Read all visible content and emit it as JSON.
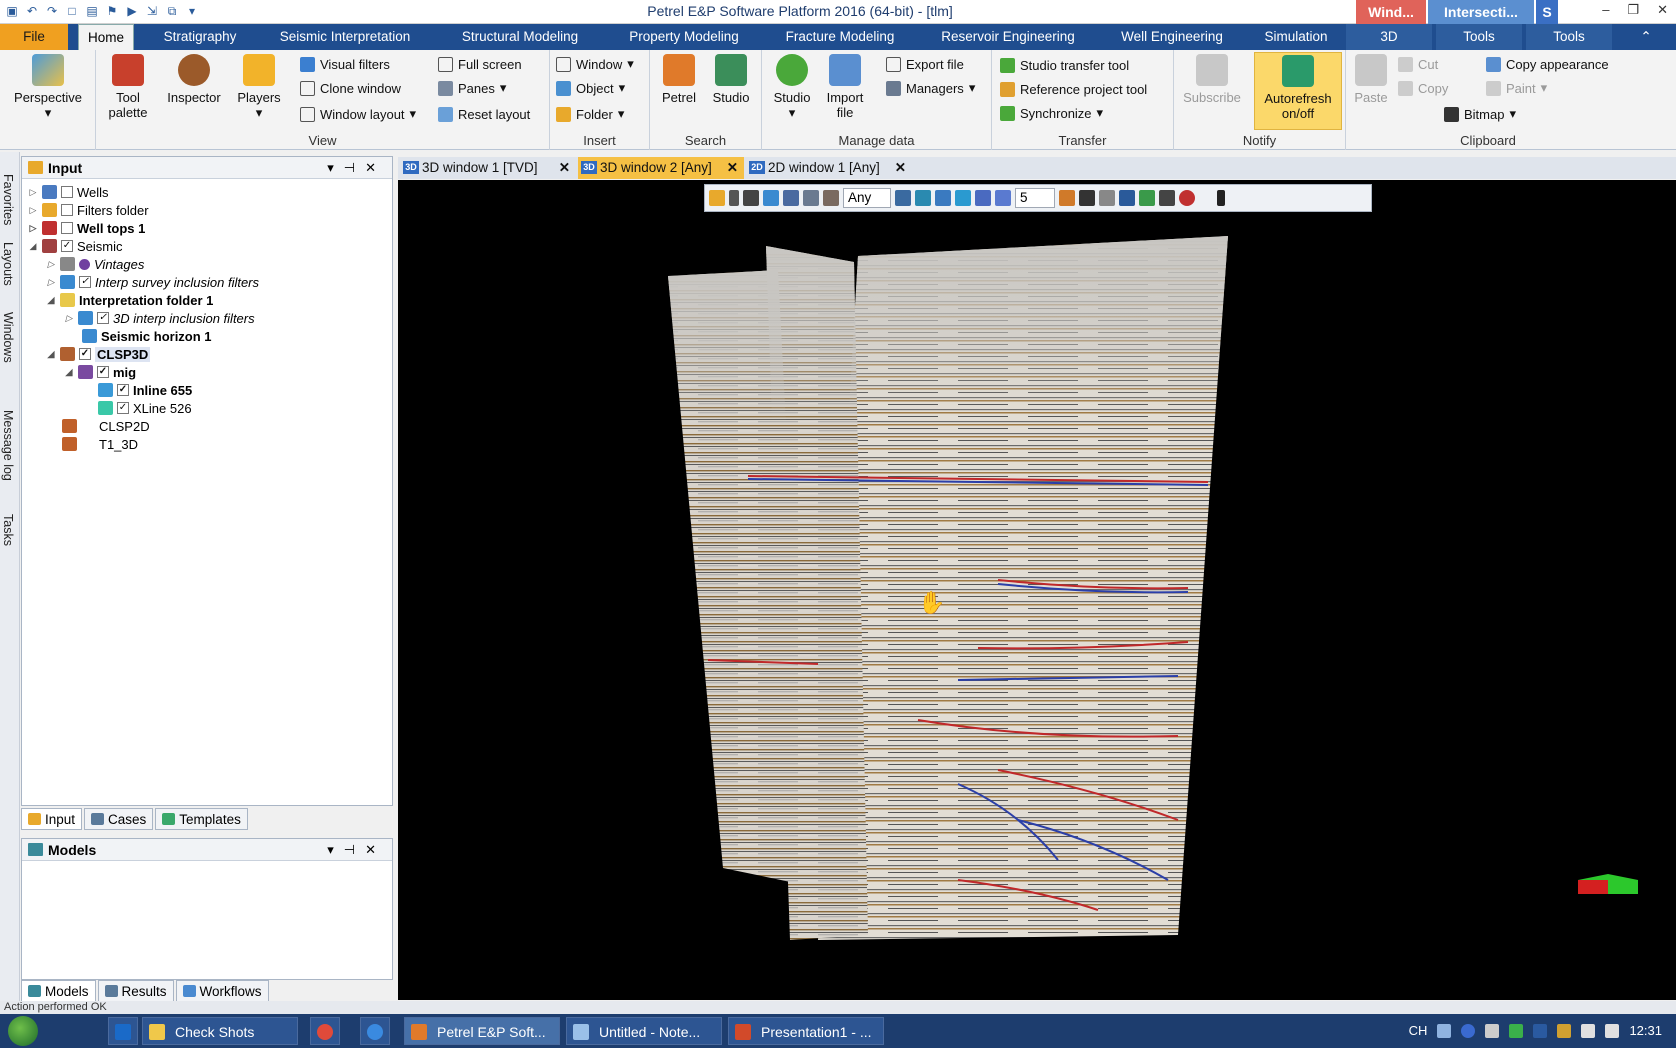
{
  "window": {
    "title": "Petrel E&P Software Platform 2016 (64-bit) - [tlm]",
    "context_tabs": [
      "Wind...",
      "Intersecti...",
      "S"
    ],
    "min": "–",
    "max": "❐",
    "close": "✕"
  },
  "tabs": {
    "file": "File",
    "home": "Home",
    "items": [
      "Stratigraphy",
      "Seismic Interpretation",
      "Structural Modeling",
      "Property Modeling",
      "Fracture Modeling",
      "Reservoir Engineering",
      "Well Engineering",
      "Simulation",
      "3D",
      "Tools",
      "Tools"
    ]
  },
  "ribbon": {
    "perspective": "Perspective",
    "view": {
      "label": "View",
      "tool_palette": "Tool palette",
      "inspector": "Inspector",
      "players": "Players",
      "visual_filters": "Visual filters",
      "clone_window": "Clone window",
      "window_layout": "Window layout",
      "full_screen": "Full screen",
      "panes": "Panes",
      "reset_layout": "Reset layout"
    },
    "insert": {
      "label": "Insert",
      "window": "Window",
      "object": "Object",
      "folder": "Folder"
    },
    "search": {
      "label": "Search",
      "petrel": "Petrel",
      "studio": "Studio"
    },
    "manage": {
      "label": "Manage data",
      "studio": "Studio",
      "import_file": "Import file",
      "export_file": "Export file",
      "managers": "Managers"
    },
    "transfer": {
      "label": "Transfer",
      "studio_transfer": "Studio transfer tool",
      "reference_project": "Reference project tool",
      "synchronize": "Synchronize"
    },
    "notify": {
      "label": "Notify",
      "subscribe": "Subscribe",
      "autorefresh": "Autorefresh on/off"
    },
    "clipboard": {
      "label": "Clipboard",
      "paste": "Paste",
      "cut": "Cut",
      "copy": "Copy",
      "copy_appearance": "Copy appearance",
      "paint": "Paint",
      "bitmap": "Bitmap"
    }
  },
  "side_strip": [
    "Favorites",
    "Layouts",
    "Windows",
    "Message log",
    "Tasks"
  ],
  "input_panel": {
    "title": "Input",
    "tree": [
      "Wells",
      "Filters folder",
      "Well tops 1",
      "Seismic",
      "Vintages",
      "Interp survey inclusion filters",
      "Interpretation folder 1",
      "3D interp inclusion filters",
      "Seismic horizon 1",
      "CLSP3D",
      "mig",
      "Inline 655",
      "XLine 526",
      "CLSP2D",
      "T1_3D"
    ]
  },
  "input_tabs": [
    "Input",
    "Cases",
    "Templates"
  ],
  "models_panel": {
    "title": "Models"
  },
  "models_tabs": [
    "Models",
    "Results",
    "Workflows"
  ],
  "view_tabs": [
    {
      "badge": "3D",
      "label": "3D window 1 [TVD]"
    },
    {
      "badge": "3D",
      "label": "3D window 2 [Any]"
    },
    {
      "badge": "2D",
      "label": "2D window 1 [Any]"
    }
  ],
  "view_toolbar": {
    "domain": "Any",
    "value": "5"
  },
  "status": "Action performed OK",
  "taskbar": {
    "items": [
      "Check Shots",
      "Petrel E&P Soft...",
      "Untitled - Note...",
      "Presentation1 - ..."
    ],
    "lang": "CH",
    "time": "12:31"
  },
  "colors": {
    "ribbon_blue": "#1f4d8f",
    "file_orange": "#f0a020",
    "active_tab": "#f5c044",
    "seis_red": "#c0282a",
    "seis_blue": "#2b3fa8"
  }
}
